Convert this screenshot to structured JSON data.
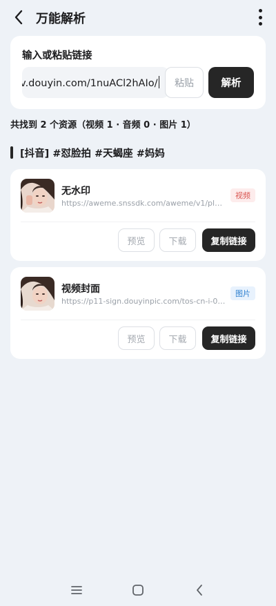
{
  "header": {
    "title": "万能解析"
  },
  "input": {
    "label": "输入或粘贴链接",
    "url_value": "v.douyin.com/1nuACl2hAIo/",
    "paste_label": "粘贴",
    "parse_label": "解析"
  },
  "summary": "共找到 2 个资源（视频 1 · 音频 0 · 图片 1）",
  "tagline": "[抖音] #怼脸拍 #天蝎座 #妈妈",
  "resources": [
    {
      "title": "无水印",
      "url": "https://aweme.snssdk.com/aweme/v1/play/?l...",
      "badge": "视频",
      "badge_color": "#d9534f",
      "preview_label": "预览",
      "download_label": "下载",
      "copy_label": "复制链接"
    },
    {
      "title": "视频封面",
      "url": "https://p11-sign.douyinpic.com/tos-cn-i-081...",
      "badge": "图片",
      "badge_color": "#2f80d0",
      "preview_label": "预览",
      "download_label": "下载",
      "copy_label": "复制链接"
    }
  ],
  "nav": {
    "icons": [
      "menu-icon",
      "home-square-icon",
      "back-chevron-icon"
    ]
  },
  "colors": {
    "background": "#eef2f7",
    "accent_dark": "#262626"
  }
}
